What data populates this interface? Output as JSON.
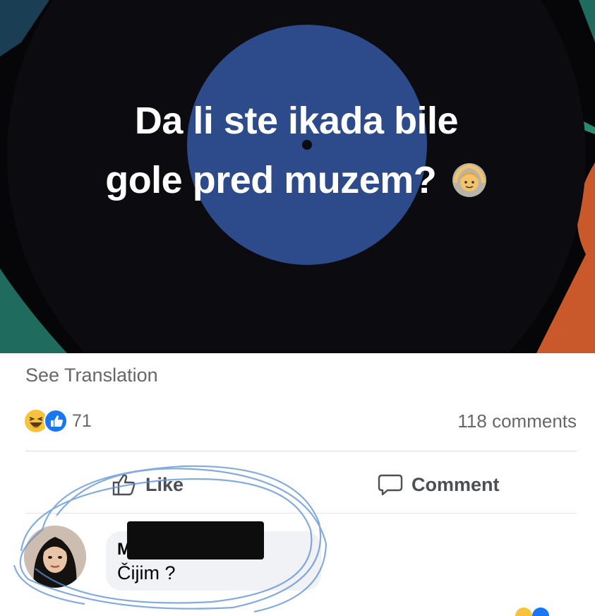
{
  "post": {
    "image_text": "Da li ste ikada bile gole pred muzem?",
    "image_text_line1": "Da li ste ikada bile",
    "image_text_line2": "gole pred muzem?",
    "emoji": "man-gesturing-ok-emoji"
  },
  "see_translation": "See Translation",
  "reactions": {
    "count": "71",
    "icons": [
      "haha-reaction-icon",
      "like-reaction-icon"
    ]
  },
  "comments_count": "118 comments",
  "actions": {
    "like_label": "Like",
    "comment_label": "Comment"
  },
  "comment": {
    "author_visible": "M",
    "text": "Čijim ?"
  },
  "colors": {
    "image_bg": "#060608",
    "record_blue": "#2d4a8a",
    "teal": "#1f6b5e",
    "orange": "#c9582a",
    "meta_text": "#65676b",
    "bubble_bg": "#f0f2f5",
    "like_blue": "#1877f2"
  }
}
